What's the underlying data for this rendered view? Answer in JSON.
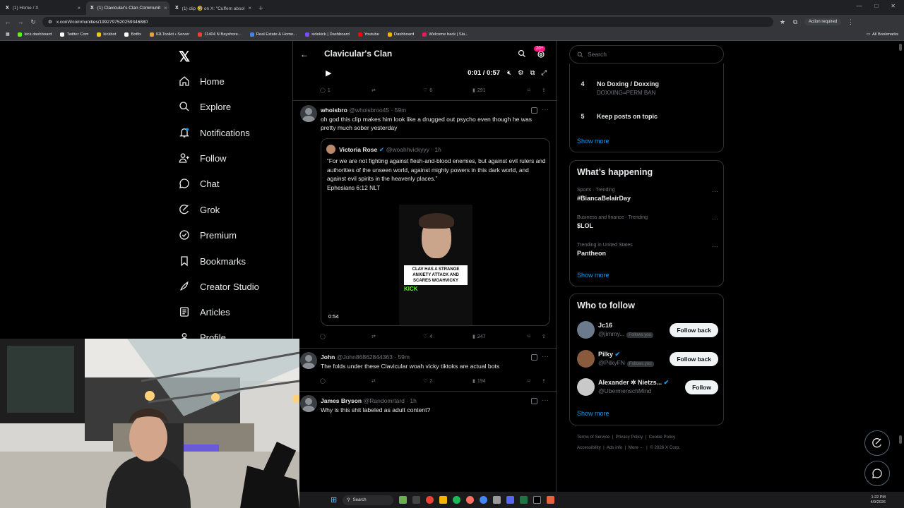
{
  "browser": {
    "tabs": [
      {
        "label": "(1) Home / X",
        "active": false
      },
      {
        "label": "(1) Clavicular's Clan Communit",
        "active": true
      },
      {
        "label": "(1) clip 🤣 on X: \"Cuffem absol",
        "active": false
      }
    ],
    "url": "x.com/i/communities/1992797520259346880",
    "action_required": "Action required",
    "bookmarks": [
      {
        "label": "kick dashboard",
        "color": "#53fc18"
      },
      {
        "label": "Twitter Com",
        "color": "#ffffff"
      },
      {
        "label": "kickbot",
        "color": "#f5c518"
      },
      {
        "label": "Botfix",
        "color": "#ffffff"
      },
      {
        "label": "IRLToolkit • Server",
        "color": "#e8a33d"
      },
      {
        "label": "11404 N Bayshore...",
        "color": "#ea4335"
      },
      {
        "label": "Real Estate & Home...",
        "color": "#4285f4"
      },
      {
        "label": "sidekick | Dashboard",
        "color": "#7c4dff"
      },
      {
        "label": "Youtube",
        "color": "#ff0000"
      },
      {
        "label": "Dashboard",
        "color": "#f4b400"
      },
      {
        "label": "Welcome back | Sla...",
        "color": "#e01e5a"
      }
    ],
    "all_bookmarks": "All Bookmarks"
  },
  "nav": {
    "items": [
      {
        "label": "Home",
        "icon": "home-icon"
      },
      {
        "label": "Explore",
        "icon": "search-icon"
      },
      {
        "label": "Notifications",
        "icon": "bell-icon"
      },
      {
        "label": "Follow",
        "icon": "follow-icon"
      },
      {
        "label": "Chat",
        "icon": "chat-icon"
      },
      {
        "label": "Grok",
        "icon": "grok-icon"
      },
      {
        "label": "Premium",
        "icon": "premium-icon"
      },
      {
        "label": "Bookmarks",
        "icon": "bookmark-icon"
      },
      {
        "label": "Creator Studio",
        "icon": "rocket-icon"
      },
      {
        "label": "Articles",
        "icon": "articles-icon"
      },
      {
        "label": "Profile",
        "icon": "profile-icon"
      }
    ]
  },
  "header": {
    "title": "Clavicular's Clan",
    "badge": "20+"
  },
  "player": {
    "time": "0:01 / 0:57"
  },
  "first_actions": {
    "replies": "1",
    "reposts": "",
    "likes": "6",
    "views": "291"
  },
  "tweets": [
    {
      "name": "whoisbro",
      "handle": "@whoisbroo45 · 59m",
      "text": "oh god this clip makes him look like a drugged out psycho even though he was pretty much sober yesterday",
      "quote": {
        "name": "Victoria Rose",
        "handle": "@woahhvickyyy · 1h",
        "text": "“For we are not fighting against flesh-and-blood enemies, but against evil rulers and authorities of the unseen world, against mighty powers in this dark world, and against evil spirits in the heavenly places.”",
        "ref": "Ephesians 6:12 NLT",
        "video_caption": "CLAV HAS A STRANGE ANXIETY ATTACK AND SCARES WOAHVICKY",
        "video_brand": "KICK",
        "duration": "0:54"
      },
      "stats": {
        "replies": "",
        "reposts": "",
        "likes": "4",
        "views": "247"
      }
    },
    {
      "name": "John",
      "handle": "@John86862844363 · 59m",
      "text": "The folds under these Clavicular woah vicky tiktoks are actual bots",
      "stats": {
        "replies": "",
        "reposts": "",
        "likes": "2",
        "views": "194"
      }
    },
    {
      "name": "James Bryson",
      "handle": "@Randomrtard · 1h",
      "text": "Why is this shit labeled as adult content?"
    }
  ],
  "right": {
    "search_placeholder": "Search",
    "rules": [
      {
        "num": "4",
        "title": "No Doxing / Doxxing",
        "sub": "DOXXING=PERM BAN"
      },
      {
        "num": "5",
        "title": "Keep posts on topic",
        "sub": ""
      }
    ],
    "show_more": "Show more",
    "happening_title": "What’s happening",
    "trends": [
      {
        "cat": "Sports · Trending",
        "name": "#BiancaBelairDay"
      },
      {
        "cat": "Business and finance · Trending",
        "name": "$LOL"
      },
      {
        "cat": "Trending in United States",
        "name": "Pantheon"
      }
    ],
    "who_title": "Who to follow",
    "who": [
      {
        "name": "Jc16",
        "handle": "@jimmy...",
        "follows_you": "Follows you",
        "button": "Follow back",
        "color": "#6b7a8c"
      },
      {
        "name": "Pilky",
        "handle": "@PilkyFN",
        "follows_you": "Follows you",
        "button": "Follow back",
        "color": "#8a5a3c"
      },
      {
        "name": "Alexander ✲ Nietzs...",
        "handle": "@UbermenschMind",
        "follows_you": "",
        "button": "Follow",
        "color": "#c9c9c9"
      }
    ],
    "footer_line1": [
      "Terms of Service",
      "Privacy Policy",
      "Cookie Policy"
    ],
    "footer_line2": [
      "Accessibility",
      "Ads info",
      "More ···",
      "© 2026 X Corp."
    ]
  },
  "taskbar": {
    "search": "Search",
    "time": "1:22 PM",
    "date": "4/9/2026"
  }
}
